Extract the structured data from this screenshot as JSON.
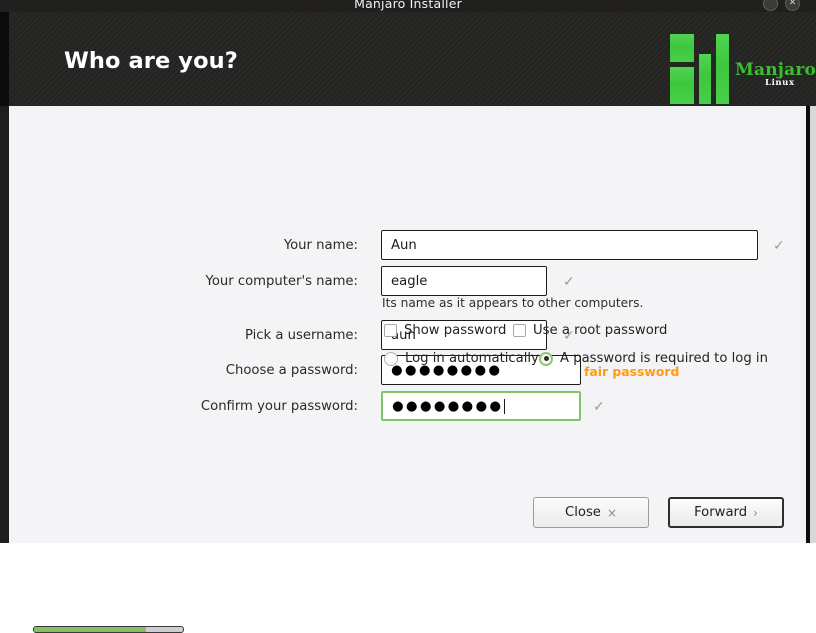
{
  "window": {
    "title": "Manjaro Installer",
    "shade_icon": "chevron-down-icon",
    "close_icon": "close-icon"
  },
  "header": {
    "title": "Who are you?",
    "logo": {
      "wordmark": "Manjaro",
      "subtitle": "Linux",
      "accent_color": "#3bbf2e"
    }
  },
  "form": {
    "fields": [
      {
        "label": "Your name:",
        "value": "Aun",
        "valid_icon": "checkmark-icon"
      },
      {
        "label": "Your computer's name:",
        "value": "eagle",
        "hint": "Its name as it appears to other computers.",
        "valid_icon": "checkmark-icon"
      },
      {
        "label": "Pick a username:",
        "value": "aun",
        "valid_icon": "checkmark-icon"
      },
      {
        "label": "Choose a password:",
        "value": "●●●●●●●●",
        "strength": "fair password",
        "strength_color": "#ff9a16"
      },
      {
        "label": "Confirm your password:",
        "value": "●●●●●●●●",
        "focused": true,
        "valid_icon": "checkmark-icon"
      }
    ],
    "checkboxes": [
      {
        "label": "Show password",
        "checked": false
      },
      {
        "label": "Use a root password",
        "checked": false
      }
    ],
    "radios": [
      {
        "label": "Log in automatically",
        "selected": false
      },
      {
        "label": "A password is required to log in",
        "selected": true
      }
    ]
  },
  "footer": {
    "progress_percent": 75,
    "progress_color": "#84c166",
    "buttons": [
      {
        "label": "Close",
        "glyph": "×",
        "icon": "close-icon",
        "focused": false
      },
      {
        "label": "Forward",
        "glyph": "›",
        "icon": "chevron-right-icon",
        "focused": true
      }
    ]
  }
}
